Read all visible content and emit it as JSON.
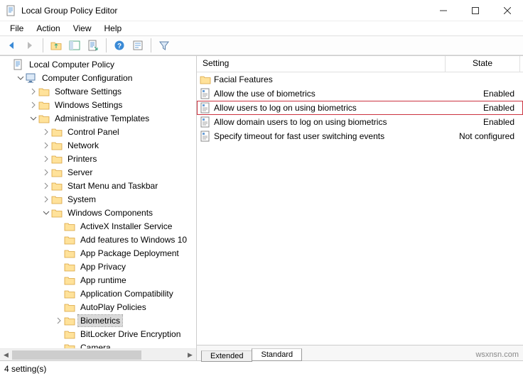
{
  "window": {
    "title": "Local Group Policy Editor"
  },
  "menus": {
    "file": "File",
    "action": "Action",
    "view": "View",
    "help": "Help"
  },
  "columns": {
    "setting": "Setting",
    "state": "State",
    "setting_width": 350,
    "state_width": 105
  },
  "tabs": {
    "extended": "Extended",
    "standard": "Standard"
  },
  "status": "4 setting(s)",
  "watermark": "wsxnsn.com",
  "tree": [
    {
      "depth": 0,
      "twisty": "",
      "icon": "doc",
      "label": "Local Computer Policy"
    },
    {
      "depth": 1,
      "twisty": "open",
      "icon": "comp",
      "label": "Computer Configuration"
    },
    {
      "depth": 2,
      "twisty": "closed",
      "icon": "folder",
      "label": "Software Settings"
    },
    {
      "depth": 2,
      "twisty": "closed",
      "icon": "folder",
      "label": "Windows Settings"
    },
    {
      "depth": 2,
      "twisty": "open",
      "icon": "folder",
      "label": "Administrative Templates"
    },
    {
      "depth": 3,
      "twisty": "closed",
      "icon": "folder",
      "label": "Control Panel"
    },
    {
      "depth": 3,
      "twisty": "closed",
      "icon": "folder",
      "label": "Network"
    },
    {
      "depth": 3,
      "twisty": "closed",
      "icon": "folder",
      "label": "Printers"
    },
    {
      "depth": 3,
      "twisty": "closed",
      "icon": "folder",
      "label": "Server"
    },
    {
      "depth": 3,
      "twisty": "closed",
      "icon": "folder",
      "label": "Start Menu and Taskbar"
    },
    {
      "depth": 3,
      "twisty": "closed",
      "icon": "folder",
      "label": "System"
    },
    {
      "depth": 3,
      "twisty": "open",
      "icon": "folder",
      "label": "Windows Components"
    },
    {
      "depth": 4,
      "twisty": "",
      "icon": "folder",
      "label": "ActiveX Installer Service"
    },
    {
      "depth": 4,
      "twisty": "",
      "icon": "folder",
      "label": "Add features to Windows 10"
    },
    {
      "depth": 4,
      "twisty": "",
      "icon": "folder",
      "label": "App Package Deployment"
    },
    {
      "depth": 4,
      "twisty": "",
      "icon": "folder",
      "label": "App Privacy"
    },
    {
      "depth": 4,
      "twisty": "",
      "icon": "folder",
      "label": "App runtime"
    },
    {
      "depth": 4,
      "twisty": "",
      "icon": "folder",
      "label": "Application Compatibility"
    },
    {
      "depth": 4,
      "twisty": "",
      "icon": "folder",
      "label": "AutoPlay Policies"
    },
    {
      "depth": 4,
      "twisty": "closed",
      "icon": "folder",
      "label": "Biometrics",
      "selected": true
    },
    {
      "depth": 4,
      "twisty": "",
      "icon": "folder",
      "label": "BitLocker Drive Encryption"
    },
    {
      "depth": 4,
      "twisty": "",
      "icon": "folder",
      "label": "Camera"
    }
  ],
  "settings": [
    {
      "icon": "folder",
      "name": "Facial Features",
      "state": ""
    },
    {
      "icon": "policy",
      "name": "Allow the use of biometrics",
      "state": "Enabled"
    },
    {
      "icon": "policy",
      "name": "Allow users to log on using biometrics",
      "state": "Enabled",
      "highlight": true
    },
    {
      "icon": "policy",
      "name": "Allow domain users to log on using biometrics",
      "state": "Enabled"
    },
    {
      "icon": "policy",
      "name": "Specify timeout for fast user switching events",
      "state": "Not configured"
    }
  ]
}
